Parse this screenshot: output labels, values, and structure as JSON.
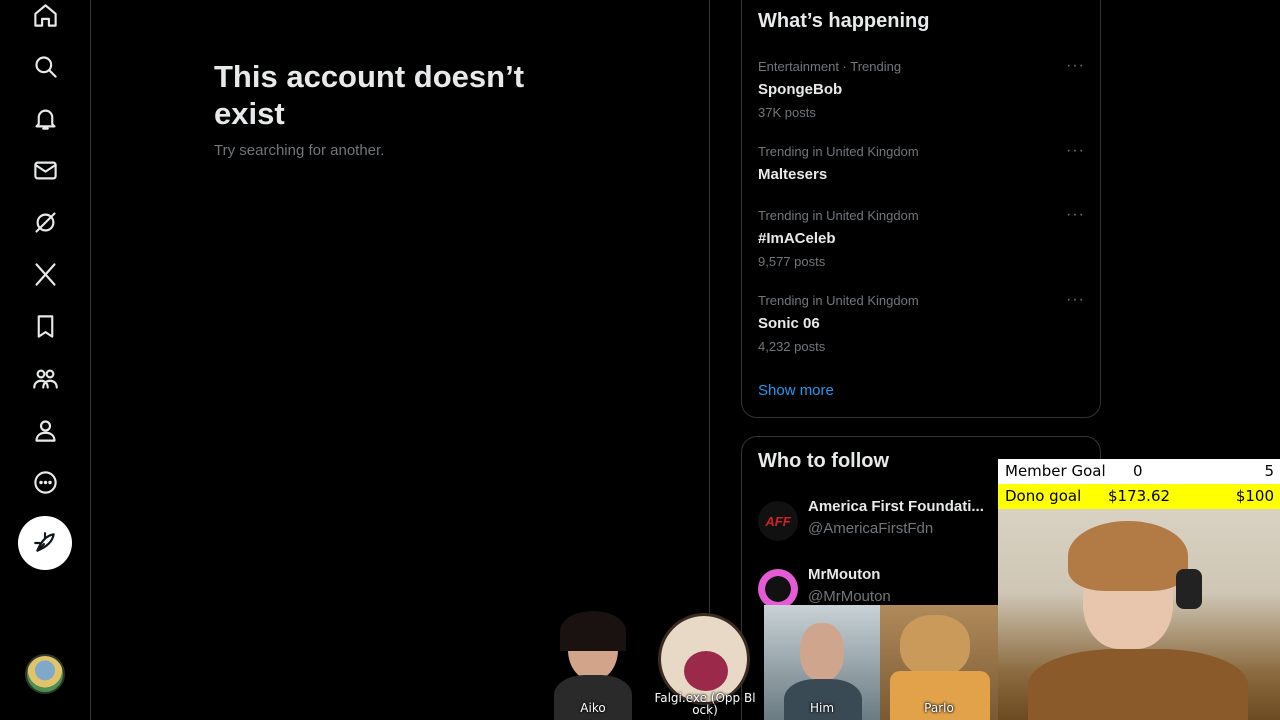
{
  "nav": {
    "items": [
      "home-icon",
      "search-icon",
      "bell-icon",
      "mail-icon",
      "grok-icon",
      "x-logo-icon",
      "bookmark-icon",
      "communities-icon",
      "profile-icon",
      "more-icon"
    ],
    "post_icon": "feather-icon"
  },
  "main": {
    "title": "This account doesn’t exist",
    "subtitle": "Try searching for another."
  },
  "trends": {
    "title": "What’s happening",
    "items": [
      {
        "meta": "Entertainment · Trending",
        "name": "SpongeBob",
        "count": "37K posts"
      },
      {
        "meta": "Trending in United Kingdom",
        "name": "Maltesers",
        "count": ""
      },
      {
        "meta": "Trending in United Kingdom",
        "name": "#ImACeleb",
        "count": "9,577 posts"
      },
      {
        "meta": "Trending in United Kingdom",
        "name": "Sonic 06",
        "count": "4,232 posts"
      }
    ],
    "more_label": "···",
    "show_more": "Show more"
  },
  "who_to_follow": {
    "title": "Who to follow",
    "accounts": [
      {
        "name": "America First Foundati...",
        "handle": "@AmericaFirstFdn",
        "avatar_text": "AFF"
      },
      {
        "name": "MrMouton",
        "handle": "@MrMouton"
      }
    ]
  },
  "overlay": {
    "member_goal": {
      "label": "Member Goal",
      "current": "0",
      "target": "5"
    },
    "dono_goal": {
      "label": "Dono goal",
      "current": "$173.62",
      "target": "$100"
    },
    "guests": [
      "Aiko",
      "Falgi.exe (Opp Bl ock)",
      "Him",
      "Parlo"
    ]
  },
  "colors": {
    "accent": "#1d9bf0",
    "background": "#000000",
    "goal_highlight": "#ffff00"
  }
}
